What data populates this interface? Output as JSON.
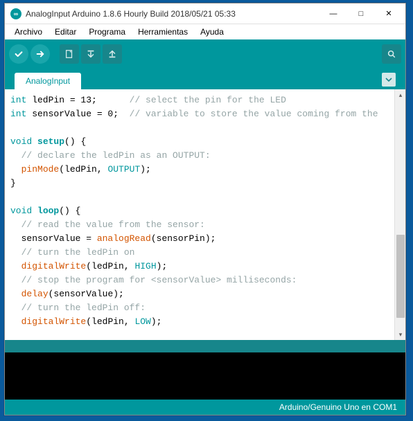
{
  "titlebar": {
    "title": "AnalogInput Arduino 1.8.6 Hourly Build 2018/05/21 05:33"
  },
  "menu": {
    "file": "Archivo",
    "edit": "Editar",
    "sketch": "Programa",
    "tools": "Herramientas",
    "help": "Ayuda"
  },
  "tab": {
    "name": "AnalogInput"
  },
  "status": {
    "board": "Arduino/Genuino Uno en COM1"
  },
  "code": {
    "l1_a": "int",
    "l1_b": " ledPin = 13;      ",
    "l1_c": "// select the pin for the LED",
    "l2_a": "int",
    "l2_b": " sensorValue = 0;  ",
    "l2_c": "// variable to store the value coming from the",
    "l3": "",
    "l4_a": "void",
    "l4_b": " ",
    "l4_c": "setup",
    "l4_d": "() {",
    "l5_a": "  ",
    "l5_b": "// declare the ledPin as an OUTPUT:",
    "l6_a": "  ",
    "l6_b": "pinMode",
    "l6_c": "(ledPin, ",
    "l6_d": "OUTPUT",
    "l6_e": ");",
    "l7": "}",
    "l8": "",
    "l9_a": "void",
    "l9_b": " ",
    "l9_c": "loop",
    "l9_d": "() {",
    "l10_a": "  ",
    "l10_b": "// read the value from the sensor:",
    "l11_a": "  sensorValue = ",
    "l11_b": "analogRead",
    "l11_c": "(sensorPin);",
    "l12_a": "  ",
    "l12_b": "// turn the ledPin on",
    "l13_a": "  ",
    "l13_b": "digitalWrite",
    "l13_c": "(ledPin, ",
    "l13_d": "HIGH",
    "l13_e": ");",
    "l14_a": "  ",
    "l14_b": "// stop the program for <sensorValue> milliseconds:",
    "l15_a": "  ",
    "l15_b": "delay",
    "l15_c": "(sensorValue);",
    "l16_a": "  ",
    "l16_b": "// turn the ledPin off:",
    "l17_a": "  ",
    "l17_b": "digitalWrite",
    "l17_c": "(ledPin, ",
    "l17_d": "LOW",
    "l17_e": ");"
  }
}
